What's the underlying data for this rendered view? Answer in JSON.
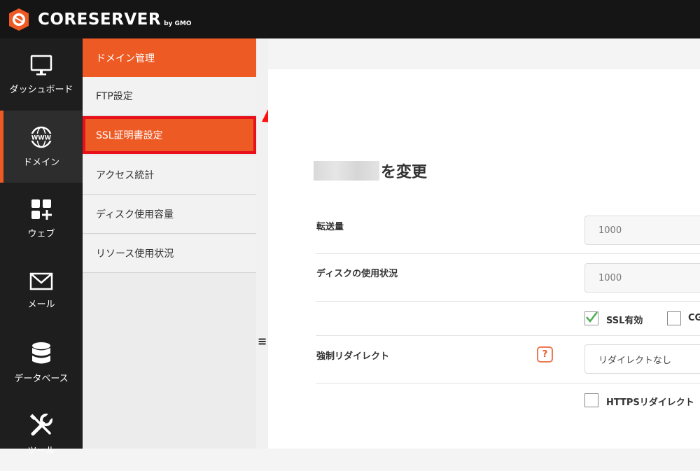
{
  "header": {
    "brand": "CORESERVER",
    "brand_sub": "by GMO"
  },
  "rail": {
    "items": [
      {
        "label": "ダッシュボード",
        "icon": "monitor-icon"
      },
      {
        "label": "ドメイン",
        "icon": "www-globe-icon",
        "active": true
      },
      {
        "label": "ウェブ",
        "icon": "grid-plus-icon"
      },
      {
        "label": "メール",
        "icon": "envelope-icon"
      },
      {
        "label": "データベース",
        "icon": "database-icon"
      },
      {
        "label": "ツール",
        "icon": "tools-icon"
      }
    ]
  },
  "submenu": {
    "items": [
      {
        "label": "ドメイン管理"
      },
      {
        "label": "FTP設定"
      },
      {
        "label": "SSL証明書設定"
      },
      {
        "label": "アクセス統計"
      },
      {
        "label": "ディスク使用容量"
      },
      {
        "label": "リソース使用状況"
      }
    ]
  },
  "main": {
    "title_suffix": "を変更",
    "transfer_label": "転送量",
    "transfer_value": "1000",
    "disk_label": "ディスクの使用状況",
    "disk_value": "1000",
    "ssl_label": "SSL有効",
    "ssl_checked": true,
    "cgi_label": "CG",
    "redirect_label": "強制リダイレクト",
    "help_text": "?",
    "redirect_value": "リダイレクトなし",
    "https_label": "HTTPSリダイレクト"
  },
  "colors": {
    "accent": "#ee5a24",
    "highlight_border": "#e8101a",
    "topbar": "#151515",
    "rail": "#1e1e1e"
  }
}
